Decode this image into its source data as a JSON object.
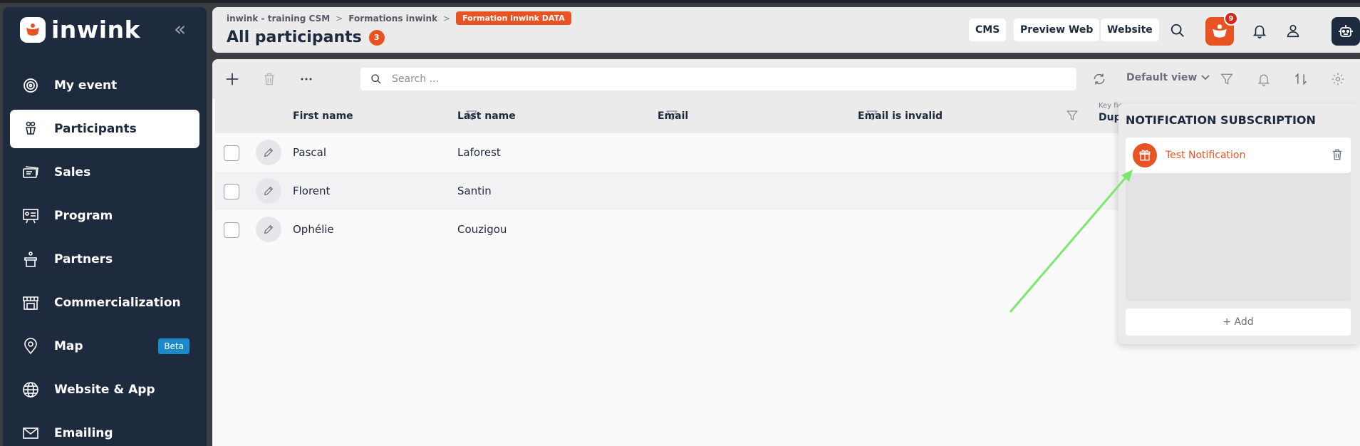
{
  "app": {
    "logo_text": "inwink"
  },
  "sidebar": {
    "items": [
      {
        "label": "My event",
        "icon": "target-icon"
      },
      {
        "label": "Participants",
        "icon": "participants-icon",
        "active": true
      },
      {
        "label": "Sales",
        "icon": "tickets-icon"
      },
      {
        "label": "Program",
        "icon": "presentation-icon"
      },
      {
        "label": "Partners",
        "icon": "podium-icon"
      },
      {
        "label": "Commercialization",
        "icon": "storefront-icon"
      },
      {
        "label": "Map",
        "icon": "map-pin-icon",
        "badge": "Beta"
      },
      {
        "label": "Website & App",
        "icon": "globe-icon"
      },
      {
        "label": "Emailing",
        "icon": "envelope-icon"
      }
    ]
  },
  "header": {
    "breadcrumb": [
      "inwink - training CSM",
      "Formations inwink"
    ],
    "breadcrumb_tag": "Formation inwink DATA",
    "title": "All participants",
    "count": "3",
    "buttons": [
      "CMS",
      "Preview Web",
      "Website"
    ],
    "notification_count": "9"
  },
  "toolbar": {
    "search_placeholder": "Search ...",
    "default_view": "Default view"
  },
  "table": {
    "columns": [
      "First name",
      "Last name",
      "Email",
      "Email is invalid"
    ],
    "keyfig_label": "Key fig",
    "dupl_label": "Dupl",
    "rows": [
      {
        "first": "Pascal",
        "last": "Laforest"
      },
      {
        "first": "Florent",
        "last": "Santin"
      },
      {
        "first": "Ophélie",
        "last": "Couzigou"
      }
    ]
  },
  "notification_panel": {
    "title": "NOTIFICATION SUBSCRIPTION",
    "items": [
      {
        "label": "Test Notification"
      }
    ],
    "add_label": "+ Add"
  },
  "colors": {
    "brand": "#e85323",
    "sidebar_bg": "#1e2a3d",
    "beta_badge": "#1a8ac9",
    "annotation_arrow": "#7be86b"
  }
}
